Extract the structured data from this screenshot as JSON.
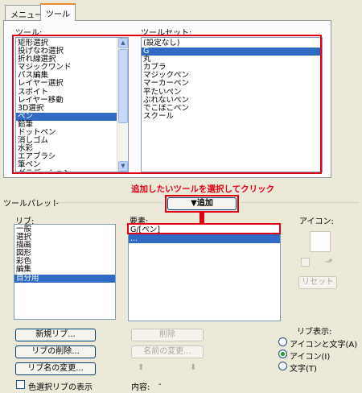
{
  "tabs": [
    {
      "label": "メニュー"
    },
    {
      "label": "ツール"
    }
  ],
  "tools_panel": {
    "tools_label": "ツール:",
    "toolset_label": "ツールセット:",
    "tools": [
      "矩形選択",
      "投げなわ選択",
      "折れ線選択",
      "マジックワンド",
      "パス編集",
      "レイヤー選択",
      "スポイト",
      "レイヤー移動",
      "3D選択",
      "ペン",
      "鉛筆",
      "ドットペン",
      "消しゴム",
      "水彩",
      "エアブラシ",
      "筆ペン",
      "グラデーション"
    ],
    "tools_selected": "ペン",
    "toolsets": [
      "(設定なし)",
      "G",
      "丸",
      "カブラ",
      "マジックペン",
      "マーカーペン",
      "平たいペン",
      "ぶれないペン",
      "でこぼこペン",
      "スクール"
    ],
    "toolsets_selected": "G"
  },
  "annotation": {
    "text": "追加したいツールを選択してクリック",
    "color": "#e00014"
  },
  "palette": {
    "group_label": "ツールパレット",
    "add_button": "▼追加",
    "ribs_label": "リブ:",
    "ribs": [
      "一般",
      "選択",
      "描画",
      "図形",
      "彩色",
      "編集",
      "自分用"
    ],
    "ribs_selected": "自分用",
    "elements_label": "要素:",
    "elements": [
      "G/[ペン]",
      "..."
    ],
    "elements_selected": "...",
    "icon_label": "アイコン:",
    "reset_button": "リセット",
    "new_rib_button": "新規リブ...",
    "delete_rib_button": "リブの削除...",
    "rename_rib_button": "リブ名の変更...",
    "delete_button": "削除",
    "rename_button": "名前の変更...",
    "up_arrow": "⬆",
    "down_arrow": "⬇",
    "color_select_checkbox": "色選択リブの表示",
    "content_label": "内容:",
    "content_value": "-",
    "rib_display_label": "リブ表示:",
    "rib_display_options": [
      "アイコンと文字(A)",
      "アイコン(I)",
      "文字(T)"
    ],
    "rib_display_selected": "アイコン(I)"
  },
  "accent_color": "#316ac5"
}
